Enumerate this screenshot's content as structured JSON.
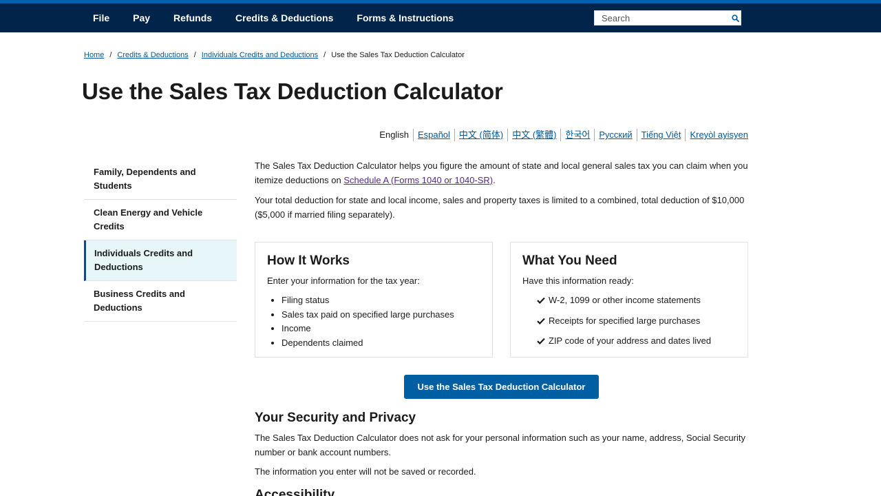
{
  "nav": {
    "items": [
      "File",
      "Pay",
      "Refunds",
      "Credits & Deductions",
      "Forms & Instructions"
    ],
    "search_placeholder": "Search"
  },
  "breadcrumb": {
    "items": [
      "Home",
      "Credits & Deductions",
      "Individuals Credits and Deductions"
    ],
    "current": "Use the Sales Tax Deduction Calculator",
    "separator": "/"
  },
  "page_title": "Use the Sales Tax Deduction Calculator",
  "languages": {
    "current": "English",
    "links": [
      "Español",
      "中文 (简体)",
      "中文 (繁體)",
      "한국어",
      "Русский",
      "Tiếng Việt",
      "Kreyòl ayisyen"
    ]
  },
  "sidebar": {
    "items": [
      {
        "label": "Family, Dependents and Students"
      },
      {
        "label": "Clean Energy and Vehicle Credits"
      },
      {
        "label": "Individuals Credits and Deductions"
      },
      {
        "label": "Business Credits and Deductions"
      }
    ]
  },
  "intro": {
    "p1_text": "The Sales Tax Deduction Calculator helps you figure the amount of state and local general sales tax you can claim when you itemize deductions on ",
    "p1_link": "Schedule A (Forms 1040 or 1040-SR)",
    "p1_end": ".",
    "p2": "Your total deduction for state and local income, sales and property taxes is limited to a combined, total deduction of $10,000 ($5,000 if married filing separately)."
  },
  "how_it_works": {
    "title": "How It Works",
    "intro": "Enter your information for the tax year:",
    "items": [
      "Filing status",
      "Sales tax paid on specified large purchases",
      "Income",
      "Dependents claimed"
    ]
  },
  "what_you_need": {
    "title": "What You Need",
    "intro": "Have this information ready:",
    "items": [
      "W-2, 1099 or other income statements",
      "Receipts for specified large purchases",
      "ZIP code of your address and dates lived"
    ]
  },
  "cta_label": "Use the Sales Tax Deduction Calculator",
  "security": {
    "title": "Your Security and Privacy",
    "p1": "The Sales Tax Deduction Calculator does not ask for your personal information such as your name, address, Social Security number or bank account numbers.",
    "p2": "The information you enter will not be saved or recorded."
  },
  "next_section_title": "Accessibility",
  "colors": {
    "nav_bg": "#00244a",
    "nav_stripe": "#0a5ea8",
    "link": "#00599c",
    "visited_link": "#54278f",
    "button": "#005ea2",
    "sidebar_active_bg": "#e7f6f8",
    "sidebar_active_border": "#1a4480"
  },
  "icons": {
    "search": "search-icon",
    "check": "check-icon"
  }
}
